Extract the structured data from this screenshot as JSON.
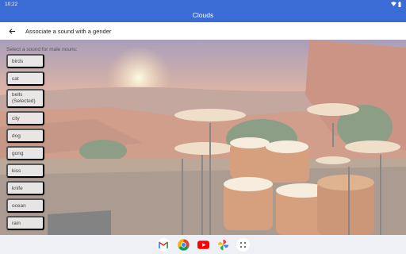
{
  "status_bar": {
    "time": "10:22"
  },
  "app_bar": {
    "title": "Clouds"
  },
  "toolbar": {
    "title": "Associate a sound with a gender"
  },
  "instruction": "Select a sound for male nouns:",
  "sounds": [
    {
      "label": "birds"
    },
    {
      "label": "cat"
    },
    {
      "label": "bells\n(Selected)",
      "selected": true
    },
    {
      "label": "city"
    },
    {
      "label": "dog"
    },
    {
      "label": "gong"
    },
    {
      "label": "kiss"
    },
    {
      "label": "knife"
    },
    {
      "label": "ocean"
    },
    {
      "label": "rain"
    }
  ],
  "dock": [
    "gmail-icon",
    "chrome-icon",
    "youtube-icon",
    "photos-icon",
    "app-drawer-icon"
  ],
  "colors": {
    "app_bar": "#3b6bd5",
    "toolbar": "#ffffff"
  }
}
